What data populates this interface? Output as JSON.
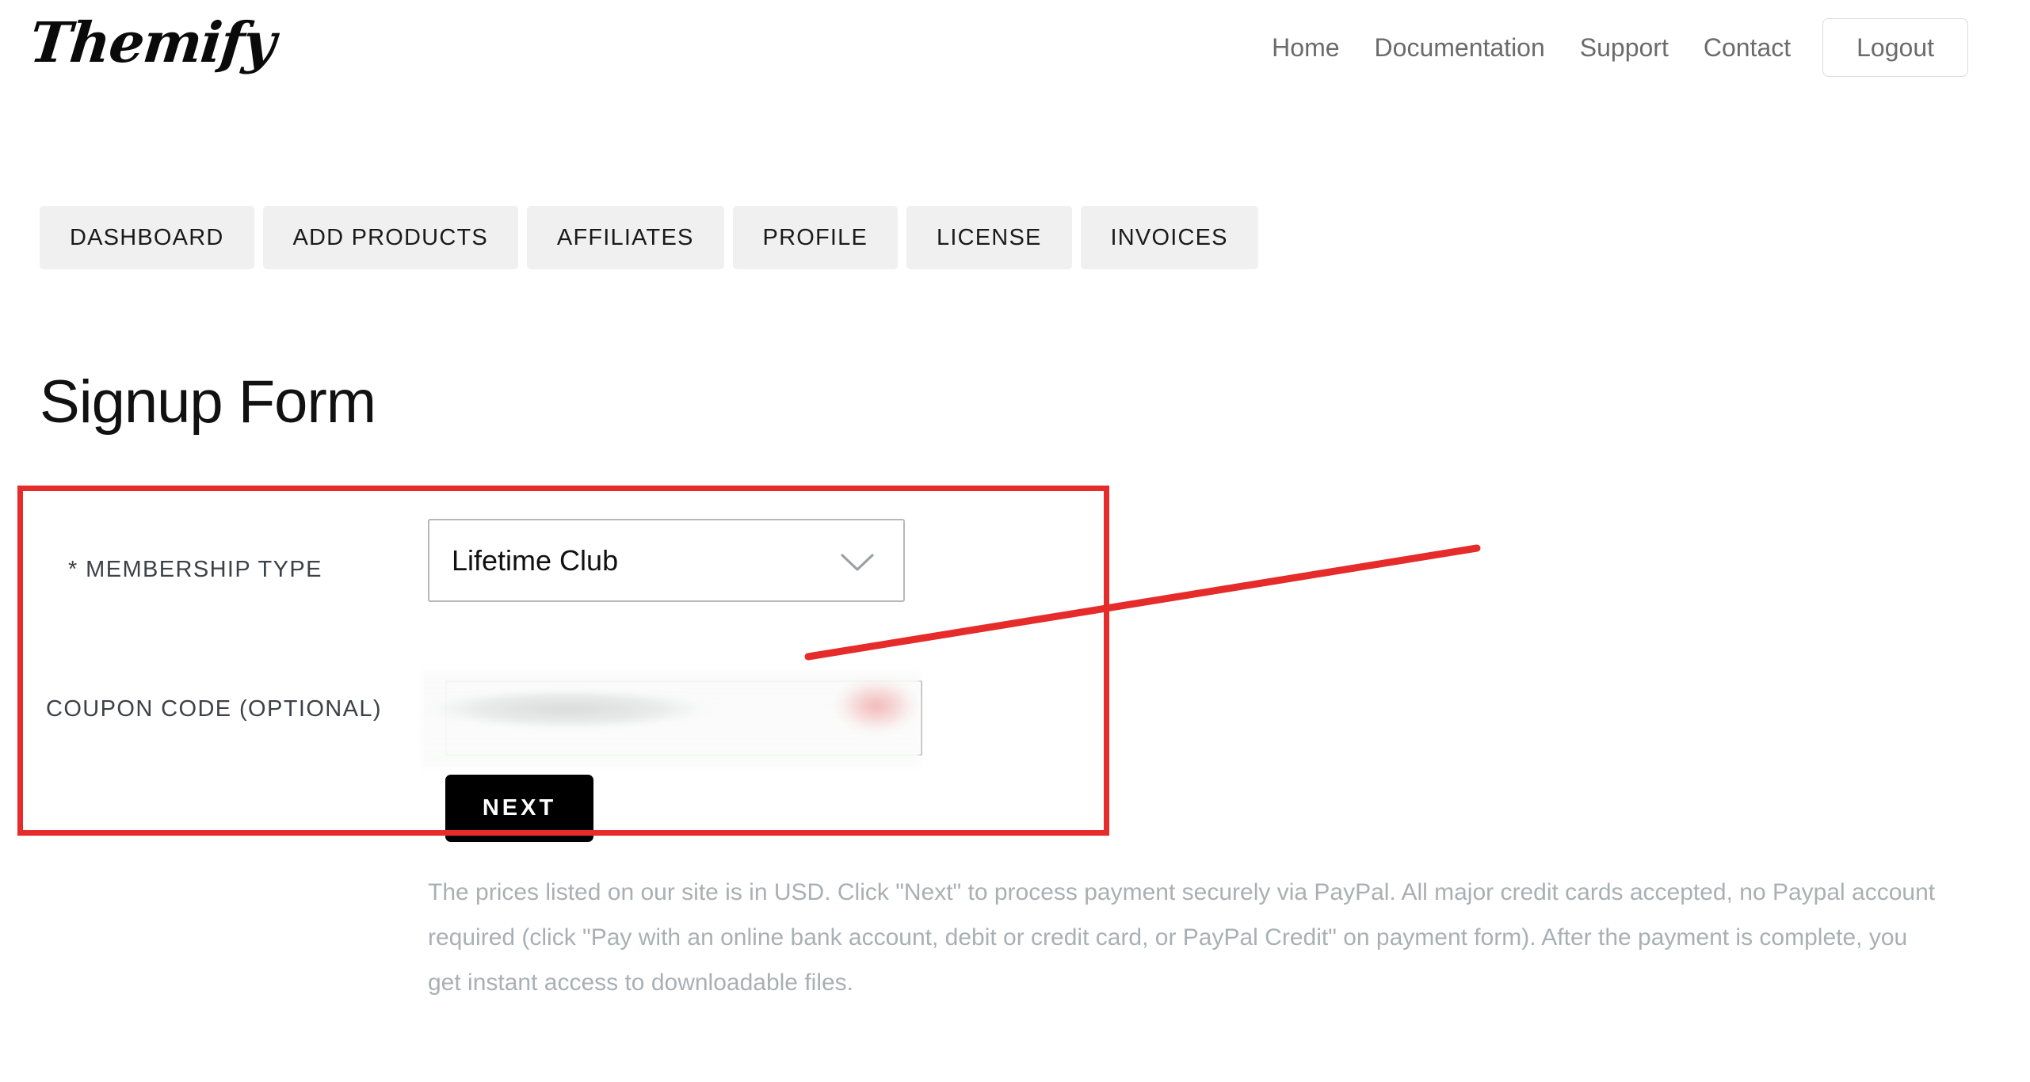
{
  "header": {
    "logo_text": "Themify",
    "logo_icon": "themify-wordmark",
    "nav": [
      {
        "label": "Home",
        "name": "nav-home"
      },
      {
        "label": "Documentation",
        "name": "nav-documentation"
      },
      {
        "label": "Support",
        "name": "nav-support"
      },
      {
        "label": "Contact",
        "name": "nav-contact"
      }
    ],
    "logout_label": "Logout"
  },
  "tabs": [
    {
      "label": "DASHBOARD"
    },
    {
      "label": "ADD PRODUCTS"
    },
    {
      "label": "AFFILIATES"
    },
    {
      "label": "PROFILE"
    },
    {
      "label": "LICENSE"
    },
    {
      "label": "INVOICES"
    }
  ],
  "page": {
    "title": "Signup Form"
  },
  "form": {
    "membership": {
      "label": "* MEMBERSHIP TYPE",
      "selected_value": "Lifetime Club",
      "chevron_icon": "chevron-down-icon"
    },
    "coupon": {
      "label": "COUPON CODE (OPTIONAL)",
      "value": "",
      "placeholder": ""
    },
    "next_label": "NEXT"
  },
  "note": {
    "text": "The prices listed on our site is in USD. Click \"Next\" to process payment securely via PayPal. All major credit cards accepted, no Paypal account required (click \"Pay with an online bank account, debit or credit card, or PayPal Credit\" on payment form). After the payment is complete, you get instant access to downloadable files."
  },
  "annotation": {
    "highlight_color": "#e62b2b",
    "arrow_color": "#e62b2b"
  }
}
